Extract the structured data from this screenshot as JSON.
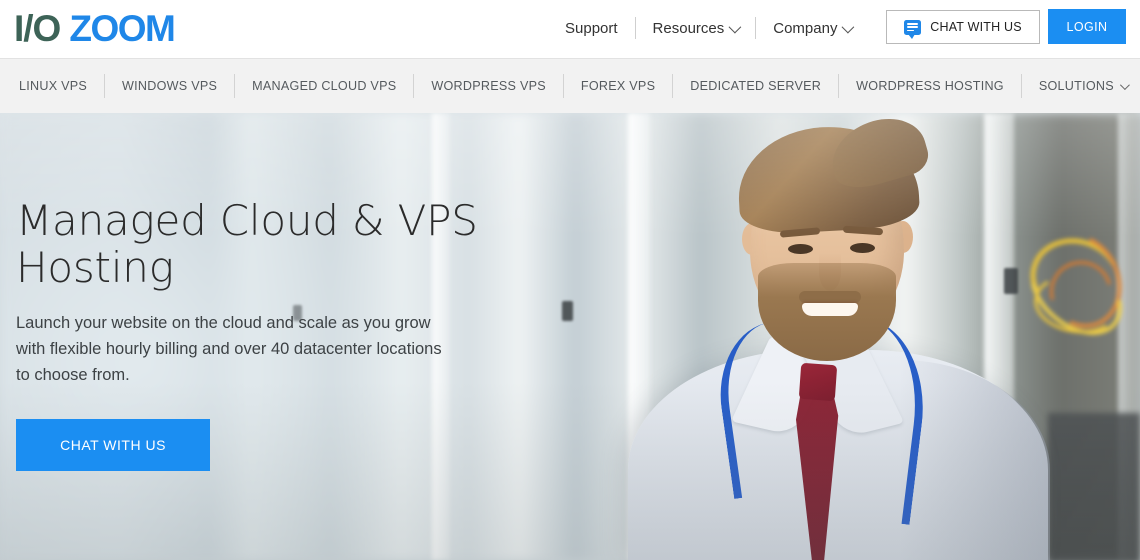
{
  "header": {
    "logo": {
      "part1": "I/O",
      "part2": "ZOOM",
      "part1_color": "#3d6357",
      "part2_color": "#1f87e8"
    },
    "nav": [
      {
        "label": "Support",
        "has_caret": false
      },
      {
        "label": "Resources",
        "has_caret": true
      },
      {
        "label": "Company",
        "has_caret": true
      }
    ],
    "chat_button": {
      "label": "CHAT WITH US",
      "icon": "chat-bubble-icon"
    },
    "login_button": {
      "label": "LOGIN",
      "color": "#1b8ef2"
    }
  },
  "subnav": {
    "items": [
      {
        "label": "LINUX VPS",
        "has_caret": false
      },
      {
        "label": "WINDOWS VPS",
        "has_caret": false
      },
      {
        "label": "MANAGED CLOUD VPS",
        "has_caret": false
      },
      {
        "label": "WORDPRESS VPS",
        "has_caret": false
      },
      {
        "label": "FOREX VPS",
        "has_caret": false
      },
      {
        "label": "DEDICATED SERVER",
        "has_caret": false
      },
      {
        "label": "WORDPRESS HOSTING",
        "has_caret": false
      },
      {
        "label": "SOLUTIONS",
        "has_caret": true
      }
    ],
    "background": "#f2f2f2"
  },
  "hero": {
    "title_line1": "Managed Cloud & VPS",
    "title_line2": "Hosting",
    "subtitle": "Launch your website on the cloud and scale as you grow with flexible hourly billing and over 40 datacenter locations to choose from.",
    "cta_label": "CHAT WITH US",
    "cta_color": "#1b8ef2",
    "background_description": "blurred data center with smiling bearded man in light shirt, maroon tie and blue lanyard"
  }
}
